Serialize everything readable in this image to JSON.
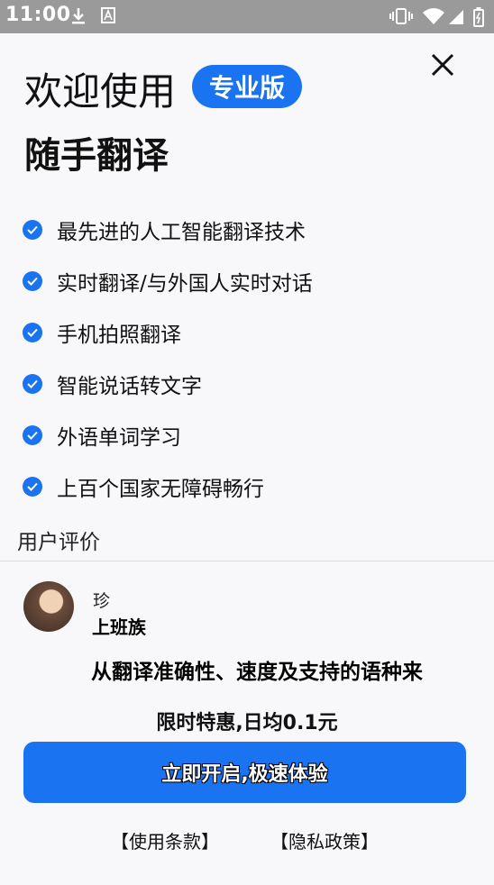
{
  "status_bar": {
    "time": "11:00",
    "icons": [
      "download-icon",
      "a-icon",
      "vibrate-icon",
      "wifi-icon",
      "signal-icon",
      "battery-icon"
    ]
  },
  "header": {
    "welcome": "欢迎使用",
    "badge": "专业版",
    "app_name": "随手翻译",
    "close_icon": "close-icon"
  },
  "features": [
    {
      "text": "最先进的人工智能翻译技术"
    },
    {
      "text": "实时翻译/与外国人实时对话"
    },
    {
      "text": "手机拍照翻译"
    },
    {
      "text": "智能说话转文字"
    },
    {
      "text": "外语单词学习"
    },
    {
      "text": "上百个国家无障碍畅行"
    }
  ],
  "reviews": {
    "title": "用户评价",
    "reviewer_name": "珍",
    "reviewer_role": "上班族",
    "text": "从翻译准确性、速度及支持的语种来"
  },
  "promo": "限时特惠,日均0.1元",
  "cta_label": "立即开启,极速体验",
  "links": {
    "terms": "【使用条款】",
    "privacy": "【隐私政策】"
  },
  "colors": {
    "accent": "#1a73f0",
    "status_bar": "#9a9a9a",
    "background": "#f8f8fa"
  }
}
